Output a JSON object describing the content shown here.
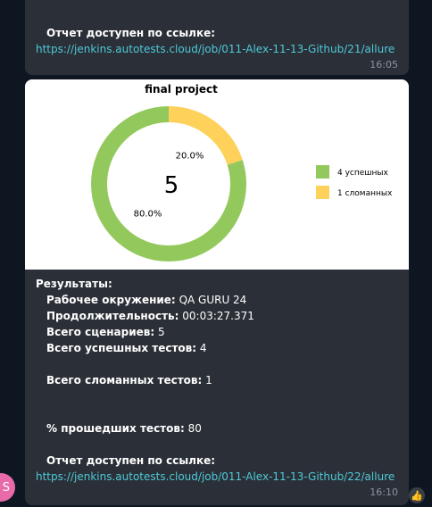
{
  "message_top": {
    "report_label": "Отчет доступен по ссылке:",
    "link": "https://jenkins.autotests.cloud/job/011-Alex-11-13-Github/21/allure",
    "time": "16:05"
  },
  "message_bottom": {
    "results_title": "Результаты:",
    "env_label": "Рабочее окружение:",
    "env_value": "QA GURU 24",
    "duration_label": "Продолжительность:",
    "duration_value": "00:03:27.371",
    "scenarios_label": "Всего сценариев:",
    "scenarios_value": "5",
    "passed_label": "Всего успешных тестов:",
    "passed_value": "4",
    "broken_label": "Всего сломанных тестов:",
    "broken_value": "1",
    "percent_label": "% прошедших тестов:",
    "percent_value": "80",
    "report_label": "Отчет доступен по ссылке:",
    "link": "https://jenkins.autotests.cloud/job/011-Alex-11-13-Github/22/allure",
    "time": "16:10"
  },
  "avatar": {
    "letter": "S"
  },
  "reaction": {
    "emoji": "👍"
  },
  "chart_data": {
    "type": "pie",
    "title": "final project",
    "center_label": "5",
    "slices": [
      {
        "name": "4 успешных",
        "value": 80.0,
        "label": "80.0%",
        "color": "#93c95c"
      },
      {
        "name": "1 сломанных",
        "value": 20.0,
        "label": "20.0%",
        "color": "#fdd15a"
      }
    ]
  }
}
